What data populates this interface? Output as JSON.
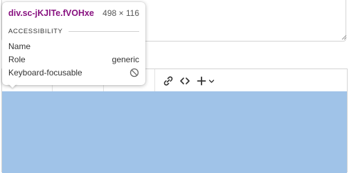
{
  "tooltip": {
    "selector": "div.sc-jKJlTe.fVOHxe",
    "dimensions": "498 × 116",
    "section_title": "ACCESSIBILITY",
    "rows": [
      {
        "label": "Name",
        "value": ""
      },
      {
        "label": "Role",
        "value": "generic"
      },
      {
        "label": "Keyboard-focusable",
        "value_icon": "not-allowed-icon"
      }
    ]
  },
  "toolbar": {
    "icons": [
      "link-icon",
      "code-icon",
      "plus-icon",
      "chevron-down-icon"
    ]
  },
  "colors": {
    "selector": "#881280",
    "highlight": "#a0c3e8",
    "border": "#d4d4d4"
  }
}
